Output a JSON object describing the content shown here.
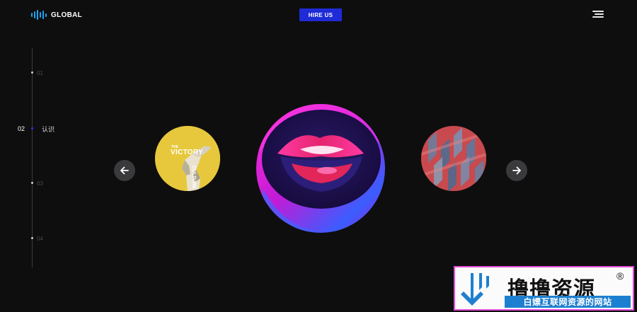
{
  "header": {
    "brand": "GLOBAL",
    "cta_label": "HIRE US"
  },
  "side_nav": {
    "items": [
      {
        "number": "01",
        "label": "",
        "active": false
      },
      {
        "number": "02",
        "label": "认识",
        "active": true
      },
      {
        "number": "03",
        "label": "",
        "active": false
      },
      {
        "number": "04",
        "label": "",
        "active": false
      }
    ]
  },
  "carousel": {
    "slides": [
      {
        "name": "victory-culture",
        "caption_small": "THE",
        "caption_big": "VICTORY",
        "caption_vertical": "CULTURE"
      },
      {
        "name": "lips",
        "caption_small": "",
        "caption_big": "",
        "caption_vertical": ""
      },
      {
        "name": "geometric-pattern",
        "caption_small": "",
        "caption_big": "",
        "caption_vertical": ""
      }
    ],
    "active_index": 1,
    "prev_icon": "arrow-left-icon",
    "next_icon": "arrow-right-icon"
  },
  "watermark": {
    "title": "撸撸资源",
    "registered": "®",
    "subtitle": "白嫖互联网资源的网站"
  },
  "colors": {
    "background": "#0e0e0f",
    "accent_blue": "#1f2bd6",
    "logo_cyan": "#1fa3f0",
    "watermark_blue": "#1d7fd0",
    "watermark_border": "#e34bd6"
  }
}
